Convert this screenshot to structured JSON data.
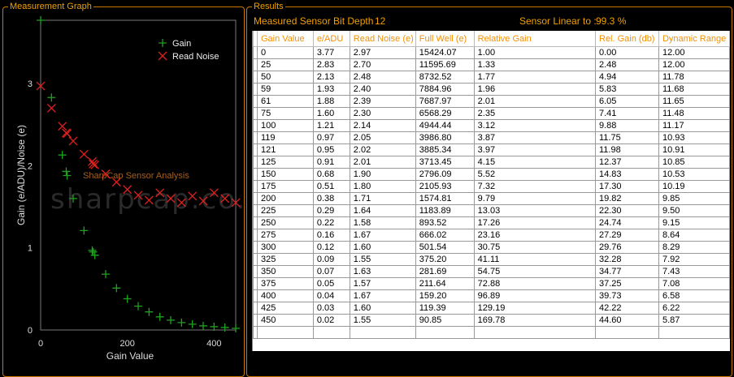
{
  "panels": {
    "graph_title": "Measurement Graph",
    "results_title": "Results"
  },
  "results": {
    "bit_depth_label": "Measured Sensor Bit Depth :",
    "bit_depth_value": "12",
    "linear_label": "Sensor Linear to :",
    "linear_value": "99.3 %"
  },
  "table": {
    "columns": [
      "Gain Value",
      "e/ADU",
      "Read Noise (e)",
      "Full Well (e)",
      "Relative Gain",
      "Rel. Gain (db)",
      "Dynamic Range"
    ],
    "rows": [
      [
        "0",
        "3.77",
        "2.97",
        "15424.07",
        "1.00",
        "0.00",
        "12.00"
      ],
      [
        "25",
        "2.83",
        "2.70",
        "11595.69",
        "1.33",
        "2.48",
        "12.00"
      ],
      [
        "50",
        "2.13",
        "2.48",
        "8732.52",
        "1.77",
        "4.94",
        "11.78"
      ],
      [
        "59",
        "1.93",
        "2.40",
        "7884.96",
        "1.96",
        "5.83",
        "11.68"
      ],
      [
        "61",
        "1.88",
        "2.39",
        "7687.97",
        "2.01",
        "6.05",
        "11.65"
      ],
      [
        "75",
        "1.60",
        "2.30",
        "6568.29",
        "2.35",
        "7.41",
        "11.48"
      ],
      [
        "100",
        "1.21",
        "2.14",
        "4944.44",
        "3.12",
        "9.88",
        "11.17"
      ],
      [
        "119",
        "0.97",
        "2.05",
        "3986.80",
        "3.87",
        "11.75",
        "10.93"
      ],
      [
        "121",
        "0.95",
        "2.02",
        "3885.34",
        "3.97",
        "11.98",
        "10.91"
      ],
      [
        "125",
        "0.91",
        "2.01",
        "3713.45",
        "4.15",
        "12.37",
        "10.85"
      ],
      [
        "150",
        "0.68",
        "1.90",
        "2796.09",
        "5.52",
        "14.83",
        "10.53"
      ],
      [
        "175",
        "0.51",
        "1.80",
        "2105.93",
        "7.32",
        "17.30",
        "10.19"
      ],
      [
        "200",
        "0.38",
        "1.71",
        "1574.81",
        "9.79",
        "19.82",
        "9.85"
      ],
      [
        "225",
        "0.29",
        "1.64",
        "1183.89",
        "13.03",
        "22.30",
        "9.50"
      ],
      [
        "250",
        "0.22",
        "1.58",
        "893.52",
        "17.26",
        "24.74",
        "9.15"
      ],
      [
        "275",
        "0.16",
        "1.67",
        "666.02",
        "23.16",
        "27.29",
        "8.64"
      ],
      [
        "300",
        "0.12",
        "1.60",
        "501.54",
        "30.75",
        "29.76",
        "8.29"
      ],
      [
        "325",
        "0.09",
        "1.55",
        "375.20",
        "41.11",
        "32.28",
        "7.92"
      ],
      [
        "350",
        "0.07",
        "1.63",
        "281.69",
        "54.75",
        "34.77",
        "7.43"
      ],
      [
        "375",
        "0.05",
        "1.57",
        "211.64",
        "72.88",
        "37.25",
        "7.08"
      ],
      [
        "400",
        "0.04",
        "1.67",
        "159.20",
        "96.89",
        "39.73",
        "6.58"
      ],
      [
        "425",
        "0.03",
        "1.60",
        "119.39",
        "129.19",
        "42.22",
        "6.22"
      ],
      [
        "450",
        "0.02",
        "1.55",
        "90.85",
        "169.78",
        "44.60",
        "5.87"
      ]
    ]
  },
  "chart_data": {
    "type": "scatter",
    "xlabel": "Gain Value",
    "ylabel": "Gain (e/ADU)/Noise (e)",
    "xlim": [
      0,
      450
    ],
    "ylim": [
      0,
      3.77
    ],
    "xticks": [
      0,
      200,
      400
    ],
    "yticks": [
      0,
      1,
      2,
      3
    ],
    "annotation": "SharpCap Sensor Analysis",
    "watermark": "sharpcap.co.uk",
    "legend_position": "top-right",
    "x": [
      0,
      25,
      50,
      59,
      61,
      75,
      100,
      119,
      121,
      125,
      150,
      175,
      200,
      225,
      250,
      275,
      300,
      325,
      350,
      375,
      400,
      425,
      450
    ],
    "series": [
      {
        "name": "Gain",
        "marker": "+",
        "color": "#1fa01f",
        "values": [
          3.77,
          2.83,
          2.13,
          1.93,
          1.88,
          1.6,
          1.21,
          0.97,
          0.95,
          0.91,
          0.68,
          0.51,
          0.38,
          0.29,
          0.22,
          0.16,
          0.12,
          0.09,
          0.07,
          0.05,
          0.04,
          0.03,
          0.02
        ]
      },
      {
        "name": "Read Noise",
        "marker": "x",
        "color": "#e02020",
        "values": [
          2.97,
          2.7,
          2.48,
          2.4,
          2.39,
          2.3,
          2.14,
          2.05,
          2.02,
          2.01,
          1.9,
          1.8,
          1.71,
          1.64,
          1.58,
          1.67,
          1.6,
          1.55,
          1.63,
          1.57,
          1.67,
          1.6,
          1.55
        ]
      }
    ]
  },
  "colors": {
    "accent": "#f0a000",
    "border": "#c87800",
    "header_text": "#f39000"
  }
}
